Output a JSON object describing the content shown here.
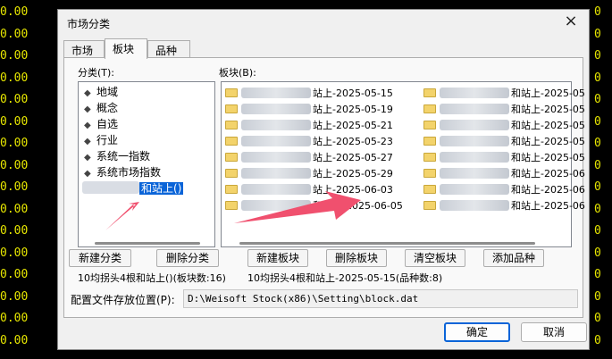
{
  "background": {
    "left_values": [
      "0.00",
      "0.00",
      "0.00",
      "0.00",
      "0.00",
      "0.00",
      "0.00",
      "0.00",
      "0.00",
      "0.00",
      "0.00",
      "0.00",
      "0.00",
      "0.00",
      "0.00",
      "0.00"
    ],
    "right_values": [
      "0",
      "0",
      "0",
      "0",
      "0",
      "0",
      "0",
      "0",
      "0",
      "0",
      "0",
      "0",
      "0",
      "0",
      "0",
      "0"
    ]
  },
  "dialog": {
    "title": "市场分类",
    "close_glyph": "×",
    "tabs": [
      {
        "label": "市场"
      },
      {
        "label": "板块"
      },
      {
        "label": "品种"
      }
    ],
    "active_tab": "板块",
    "category_label": "分类(T):",
    "block_label": "板块(B):",
    "categories": [
      {
        "label": "地域"
      },
      {
        "label": "概念"
      },
      {
        "label": "自选"
      },
      {
        "label": "行业"
      },
      {
        "label": "系统一指数"
      },
      {
        "label": "系统市场指数"
      },
      {
        "label": "和站上()"
      }
    ],
    "blocks_left": [
      {
        "label": "站上-2025-05-15"
      },
      {
        "label": "站上-2025-05-19"
      },
      {
        "label": "站上-2025-05-21"
      },
      {
        "label": "站上-2025-05-23"
      },
      {
        "label": "站上-2025-05-27"
      },
      {
        "label": "站上-2025-05-29"
      },
      {
        "label": "站上-2025-06-03"
      },
      {
        "label": "和站上-2025-06-05"
      }
    ],
    "blocks_right": [
      {
        "label": "和站上-2025-05"
      },
      {
        "label": "和站上-2025-05"
      },
      {
        "label": "和站上-2025-05"
      },
      {
        "label": "和站上-2025-05"
      },
      {
        "label": "和站上-2025-05"
      },
      {
        "label": "和站上-2025-06"
      },
      {
        "label": "和站上-2025-06"
      },
      {
        "label": "和站上-2025-06"
      }
    ],
    "buttons": {
      "new_category": "新建分类",
      "delete_category": "删除分类",
      "new_block": "新建板块",
      "delete_block": "删除板块",
      "clear_block": "清空板块",
      "add_symbol": "添加品种"
    },
    "status_category": "10均拐头4根和站上()(板块数:16)",
    "status_block": "10均拐头4根和站上-2025-05-15(品种数:8)",
    "config_label": "配置文件存放位置(P):",
    "config_path": "D:\\Weisoft Stock(x86)\\Setting\\block.dat",
    "ok": "确定",
    "cancel": "取消"
  },
  "colors": {
    "selection": "#0a64d8",
    "annotation_arrow": "#f0506e",
    "terminal_text": "#e6e600"
  }
}
